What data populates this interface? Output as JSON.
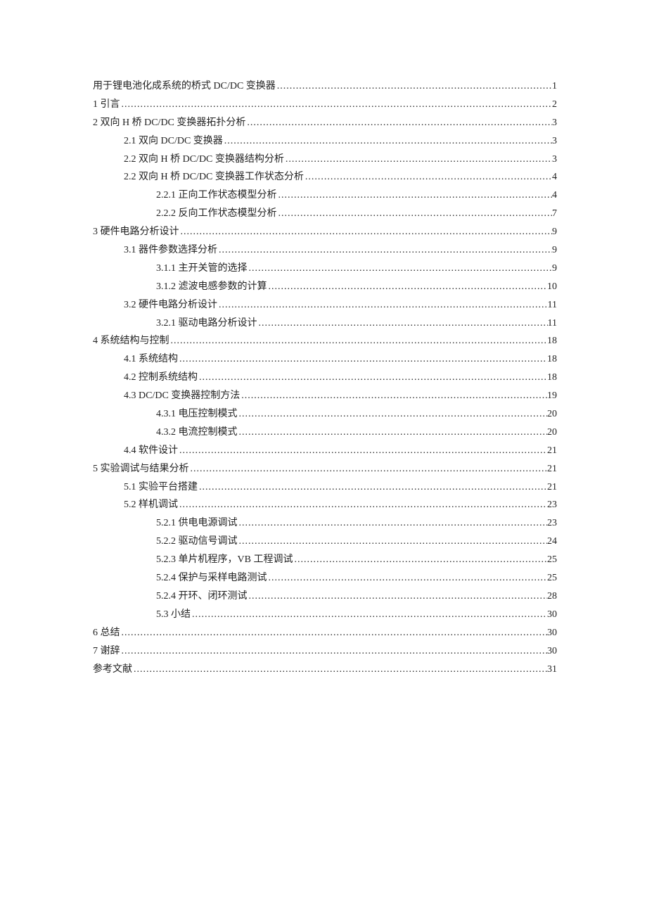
{
  "toc": [
    {
      "level": 0,
      "label": "用于锂电池化成系统的桥式 DC/DC 变换器",
      "page": "1"
    },
    {
      "level": 0,
      "label": "1 引言",
      "page": "2"
    },
    {
      "level": 0,
      "label": "2 双向 H 桥 DC/DC 变换器拓扑分析",
      "page": "3"
    },
    {
      "level": 1,
      "label": "2.1 双向 DC/DC 变换器",
      "page": "3"
    },
    {
      "level": 1,
      "label": "2.2 双向 H 桥 DC/DC 变换器结构分析",
      "page": "3"
    },
    {
      "level": 1,
      "label": "2.2 双向 H 桥 DC/DC 变换器工作状态分析",
      "page": "4"
    },
    {
      "level": 2,
      "label": "2.2.1 正向工作状态模型分析",
      "page": "4"
    },
    {
      "level": 2,
      "label": "2.2.2 反向工作状态模型分析",
      "page": "7"
    },
    {
      "level": 0,
      "label": "3 硬件电路分析设计",
      "page": "9"
    },
    {
      "level": 1,
      "label": "3.1 器件参数选择分析",
      "page": "9"
    },
    {
      "level": 2,
      "label": "3.1.1 主开关管的选择",
      "page": "9"
    },
    {
      "level": 2,
      "label": "3.1.2 滤波电感参数的计算",
      "page": "10"
    },
    {
      "level": 1,
      "label": "3.2 硬件电路分析设计",
      "page": "11"
    },
    {
      "level": 2,
      "label": "3.2.1 驱动电路分析设计",
      "page": "11"
    },
    {
      "level": 0,
      "label": "4 系统结构与控制",
      "page": "18"
    },
    {
      "level": 1,
      "label": "4.1 系统结构",
      "page": "18"
    },
    {
      "level": 1,
      "label": "4.2 控制系统结构",
      "page": "18"
    },
    {
      "level": 1,
      "label": "4.3 DC/DC 变换器控制方法",
      "page": "19"
    },
    {
      "level": 2,
      "label": "4.3.1 电压控制模式",
      "page": "20"
    },
    {
      "level": 2,
      "label": "4.3.2 电流控制模式",
      "page": "20"
    },
    {
      "level": 1,
      "label": "4.4 软件设计",
      "page": "21"
    },
    {
      "level": 0,
      "label": "5 实验调试与结果分析",
      "page": "21"
    },
    {
      "level": 1,
      "label": "5.1 实验平台搭建",
      "page": "21"
    },
    {
      "level": 1,
      "label": "5.2 样机调试",
      "page": "23"
    },
    {
      "level": 2,
      "label": "5.2.1 供电电源调试",
      "page": "23"
    },
    {
      "level": 2,
      "label": "5.2.2 驱动信号调试",
      "page": "24"
    },
    {
      "level": 2,
      "label": "5.2.3 单片机程序，VB 工程调试",
      "page": "25"
    },
    {
      "level": 2,
      "label": "5.2.4 保护与采样电路测试",
      "page": "25"
    },
    {
      "level": 2,
      "label": "5.2.4 开环、闭环测试",
      "page": "28"
    },
    {
      "level": 2,
      "label": "5.3 小结",
      "page": "30"
    },
    {
      "level": 0,
      "label": "6 总结",
      "page": "30"
    },
    {
      "level": 0,
      "label": "7 谢辞",
      "page": "30"
    },
    {
      "level": 0,
      "label": "参考文献",
      "page": "31"
    }
  ]
}
